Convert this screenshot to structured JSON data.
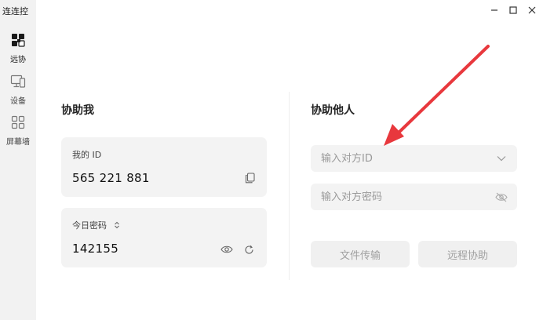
{
  "app": {
    "title": "连连控"
  },
  "sidebar": {
    "items": [
      {
        "label": "远协",
        "icon": "remote-assist-icon",
        "active": true
      },
      {
        "label": "设备",
        "icon": "device-icon",
        "active": false
      },
      {
        "label": "屏幕墙",
        "icon": "screen-wall-icon",
        "active": false
      }
    ]
  },
  "window_controls": [
    "minimize-icon",
    "maximize-icon",
    "close-icon"
  ],
  "help_me": {
    "title": "协助我",
    "id_card": {
      "label": "我的 ID",
      "value": "565 221 881",
      "action_icon": "copy-icon"
    },
    "password_card": {
      "label": "今日密码",
      "label_icon": "chevron-updown-icon",
      "value": "142155",
      "action_icons": [
        "eye-icon",
        "refresh-icon"
      ]
    }
  },
  "help_others": {
    "title": "协助他人",
    "id_input": {
      "placeholder": "输入对方ID",
      "value": "",
      "icon": "chevron-down-icon"
    },
    "password_input": {
      "placeholder": "输入对方密码",
      "value": "",
      "icon": "eye-off-icon"
    },
    "buttons": {
      "file_transfer": "文件传输",
      "remote_assist": "远程协助"
    }
  },
  "annotation": {
    "type": "red-arrow",
    "color": "#e8383d"
  },
  "colors": {
    "card_bg": "#f3f3f3",
    "sidebar_bg": "#f2f2f2",
    "button_text_disabled": "#a0a0a0"
  }
}
